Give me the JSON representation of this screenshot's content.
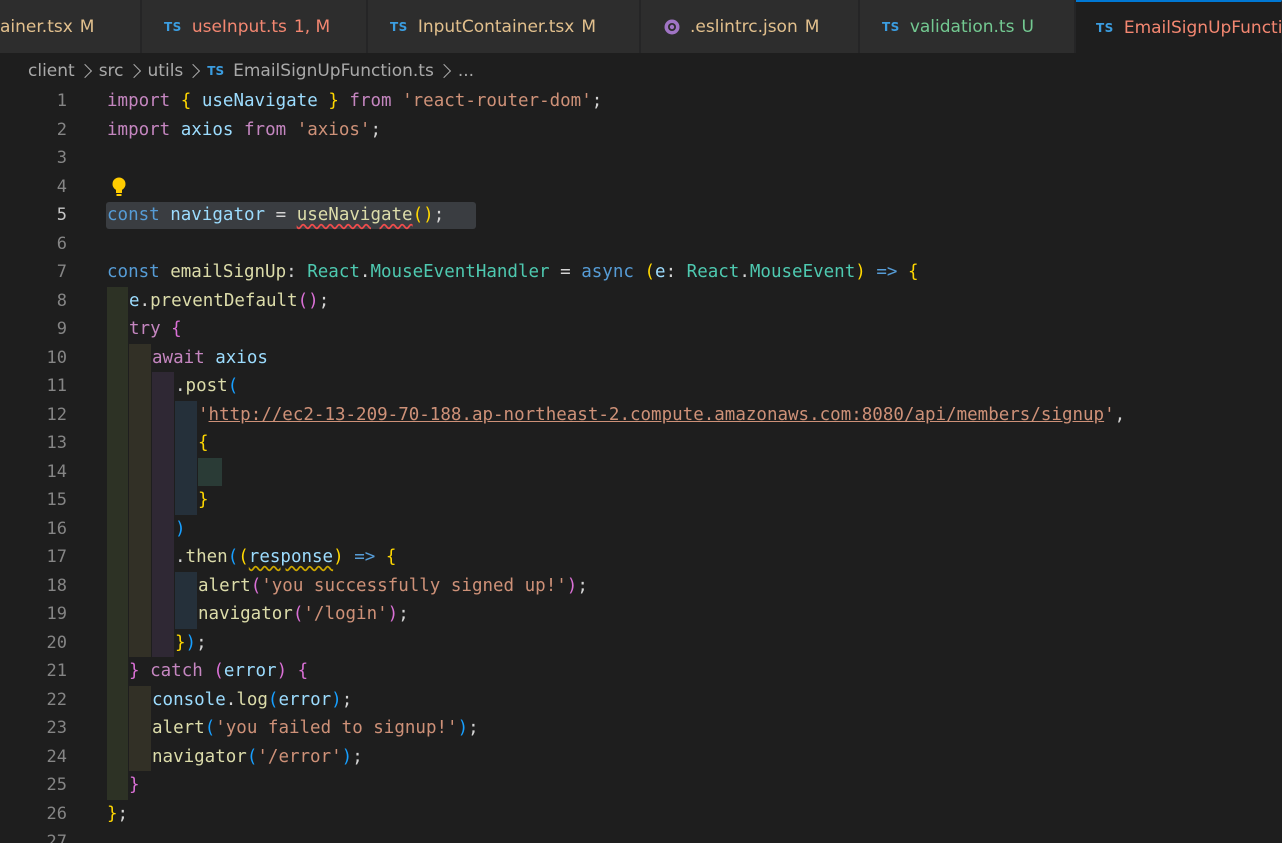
{
  "tabs": [
    {
      "icon": "",
      "name": "ainer.tsx",
      "badge": "M",
      "color": "#e2c08d"
    },
    {
      "icon": "TS",
      "name": "useInput.ts",
      "badge": "1, M",
      "color": "#f48771"
    },
    {
      "icon": "TS",
      "name": "InputContainer.tsx",
      "badge": "M",
      "color": "#e2c08d"
    },
    {
      "icon": "gear-icon",
      "name": ".eslintrc.json",
      "badge": "M",
      "color": "#e2c08d"
    },
    {
      "icon": "TS",
      "name": "validation.ts",
      "badge": "U",
      "color": "#73c991"
    },
    {
      "icon": "TS",
      "name": "EmailSignUpFuncti",
      "badge": "",
      "color": "#f48771"
    }
  ],
  "breadcrumb": {
    "parts": [
      "client",
      "src",
      "utils"
    ],
    "file_icon": "TS",
    "file": "EmailSignUpFunction.ts",
    "more": "..."
  },
  "editor": {
    "line_numbers": [
      "1",
      "2",
      "3",
      "4",
      "5",
      "6",
      "7",
      "8",
      "9",
      "10",
      "11",
      "12",
      "13",
      "14",
      "15",
      "16",
      "17",
      "18",
      "19",
      "20",
      "21",
      "22",
      "23",
      "24",
      "25",
      "26",
      "27"
    ],
    "current_line": "5",
    "code": {
      "l1": {
        "kw1": "import",
        "p_open": "{",
        "id": "useNavigate",
        "p_close": "}",
        "kw2": "from",
        "str": "'react-router-dom'",
        "end": ";"
      },
      "l2": {
        "kw1": "import",
        "id": "axios",
        "kw2": "from",
        "str": "'axios'",
        "end": ";"
      },
      "l5": {
        "kw": "const",
        "id": "navigator",
        "op": "=",
        "fn": "useNavigate",
        "parens": "()",
        "end": ";"
      },
      "l7": {
        "kw": "const",
        "id": "emailSignUp",
        "colon": ":",
        "ns": "React",
        "dot": ".",
        "type": "MouseEventHandler",
        "op": "=",
        "async": "async",
        "p_open": "(",
        "param": "e",
        "colon2": ":",
        "ns2": "React",
        "dot2": ".",
        "type2": "MouseEvent",
        "p_close": ")",
        "arrow": "=>",
        "brace": "{"
      },
      "l8": {
        "obj": "e",
        "dot": ".",
        "fn": "preventDefault",
        "parens": "()",
        "end": ";"
      },
      "l9": {
        "kw": "try",
        "brace": "{"
      },
      "l10": {
        "kw": "await",
        "id": "axios"
      },
      "l11": {
        "dot": ".",
        "fn": "post",
        "p": "("
      },
      "l12": {
        "q1": "'",
        "url": "http://ec2-13-209-70-188.ap-northeast-2.compute.amazonaws.com:8080/api/members/signup",
        "q2": "'",
        "comma": ","
      },
      "l13": {
        "brace": "{"
      },
      "l15": {
        "brace": "}"
      },
      "l16": {
        "p": ")"
      },
      "l17": {
        "dot": ".",
        "fn": "then",
        "p1": "(",
        "p2": "(",
        "param": "response",
        "p3": ")",
        "arrow": "=>",
        "brace": "{"
      },
      "l18": {
        "fn": "alert",
        "p": "(",
        "str": "'you successfully signed up!'",
        "pc": ")",
        "end": ";"
      },
      "l19": {
        "fn": "navigator",
        "p": "(",
        "str": "'/login'",
        "pc": ")",
        "end": ";"
      },
      "l20": {
        "brace": "}",
        "p": ")",
        "end": ";"
      },
      "l21": {
        "brace1": "}",
        "kw": "catch",
        "p": "(",
        "param": "error",
        "pc": ")",
        "brace2": "{"
      },
      "l22": {
        "obj": "console",
        "dot": ".",
        "fn": "log",
        "p": "(",
        "arg": "error",
        "pc": ")",
        "end": ";"
      },
      "l23": {
        "fn": "alert",
        "p": "(",
        "str": "'you failed to signup!'",
        "pc": ")",
        "end": ";"
      },
      "l24": {
        "fn": "navigator",
        "p": "(",
        "str": "'/error'",
        "pc": ")",
        "end": ";"
      },
      "l25": {
        "brace": "}"
      },
      "l26": {
        "brace": "}",
        "end": ";"
      }
    }
  }
}
